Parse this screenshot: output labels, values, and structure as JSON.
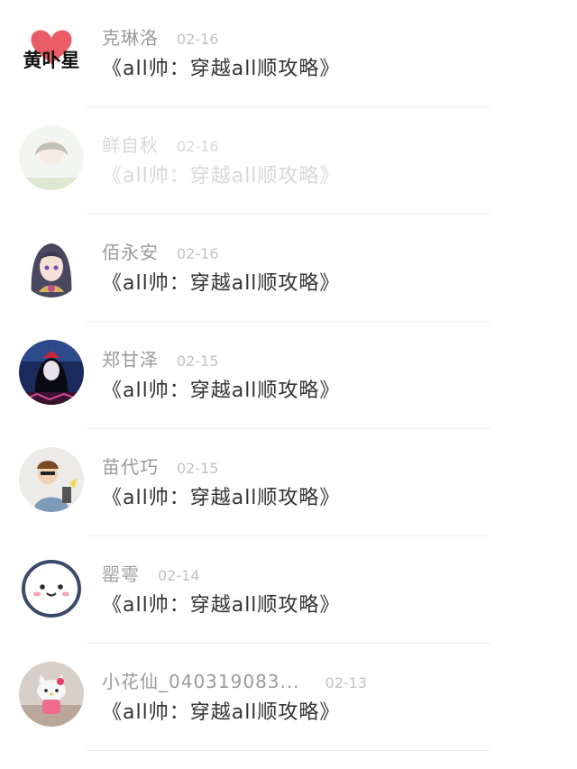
{
  "comments": [
    {
      "username": "克琳洛",
      "date": "02-16",
      "message": "《all帅：穿越all顺攻略》",
      "avatar_icon": "heart-brush-logo-avatar",
      "avatar_text": "黄卟星"
    },
    {
      "username": "鲜自秋",
      "date": "02-16",
      "message": "《all帅：穿越all顺攻略》",
      "avatar_icon": "girl-photo-avatar",
      "faded": true
    },
    {
      "username": "佰永安",
      "date": "02-16",
      "message": "《all帅：穿越all顺攻略》",
      "avatar_icon": "anime-girl-avatar"
    },
    {
      "username": "郑甘泽",
      "date": "02-15",
      "message": "《all帅：穿越all顺攻略》",
      "avatar_icon": "dark-anime-girl-avatar"
    },
    {
      "username": "苗代巧",
      "date": "02-15",
      "message": "《all帅：穿越all顺攻略》",
      "avatar_icon": "cartoon-boy-avatar"
    },
    {
      "username": "罂雩",
      "date": "02-14",
      "message": "《all帅：穿越all顺攻略》",
      "avatar_icon": "smiley-face-avatar"
    },
    {
      "username": "小花仙_040319083...",
      "date": "02-13",
      "message": "《all帅：穿越all顺攻略》",
      "avatar_icon": "hello-kitty-avatar"
    }
  ],
  "colors": {
    "username": "#9a9a9a",
    "date": "#c2c2c2",
    "message": "#333333",
    "divider": "#eeeeee"
  }
}
